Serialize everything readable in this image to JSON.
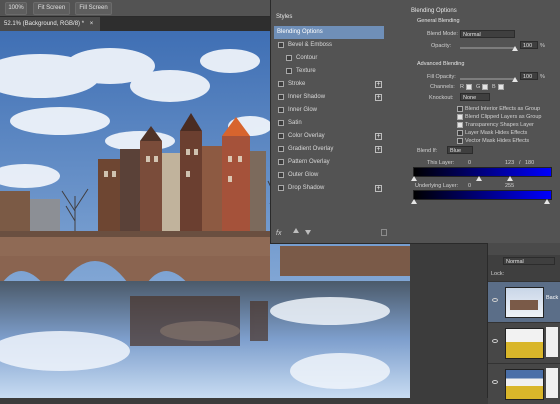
{
  "toolbar": {
    "btn1": "100%",
    "btn2": "Fit Screen",
    "btn3": "Fill Screen"
  },
  "document": {
    "tab_title": "52.1% (Background, RGB/8) *",
    "close_glyph": "×"
  },
  "layer_style": {
    "styles_header": "Styles",
    "items": [
      {
        "label": "Blending Options",
        "selected": true,
        "checkbox": false,
        "plus": false,
        "indent": false
      },
      {
        "label": "Bevel & Emboss",
        "checkbox": true,
        "checked": false,
        "plus": false,
        "indent": false
      },
      {
        "label": "Contour",
        "checkbox": true,
        "checked": false,
        "plus": false,
        "indent": true
      },
      {
        "label": "Texture",
        "checkbox": true,
        "checked": false,
        "plus": false,
        "indent": true
      },
      {
        "label": "Stroke",
        "checkbox": true,
        "checked": false,
        "plus": true,
        "indent": false
      },
      {
        "label": "Inner Shadow",
        "checkbox": true,
        "checked": false,
        "plus": true,
        "indent": false
      },
      {
        "label": "Inner Glow",
        "checkbox": true,
        "checked": false,
        "plus": false,
        "indent": false
      },
      {
        "label": "Satin",
        "checkbox": true,
        "checked": false,
        "plus": false,
        "indent": false
      },
      {
        "label": "Color Overlay",
        "checkbox": true,
        "checked": false,
        "plus": true,
        "indent": false
      },
      {
        "label": "Gradient Overlay",
        "checkbox": true,
        "checked": false,
        "plus": true,
        "indent": false
      },
      {
        "label": "Pattern Overlay",
        "checkbox": true,
        "checked": false,
        "plus": false,
        "indent": false
      },
      {
        "label": "Outer Glow",
        "checkbox": true,
        "checked": false,
        "plus": false,
        "indent": false
      },
      {
        "label": "Drop Shadow",
        "checkbox": true,
        "checked": false,
        "plus": true,
        "indent": false
      }
    ],
    "bottom_icons": [
      "fx-icon",
      "arrow-up-icon",
      "arrow-down-icon",
      "trash-icon"
    ],
    "fx_label": "fx"
  },
  "blending": {
    "title": "Blending Options",
    "general": "General Blending",
    "blend_mode_label": "Blend Mode:",
    "blend_mode_value": "Normal",
    "opacity_label": "Opacity:",
    "opacity_value": "100",
    "opacity_fraction": 1.0,
    "percent": "%",
    "advanced": "Advanced Blending",
    "fill_opacity_label": "Fill Opacity:",
    "fill_opacity_value": "100",
    "fill_fraction": 1.0,
    "channels_label": "Channels:",
    "channels": [
      {
        "name": "R",
        "checked": true
      },
      {
        "name": "G",
        "checked": true
      },
      {
        "name": "B",
        "checked": true
      }
    ],
    "knockout_label": "Knockout:",
    "knockout_value": "None",
    "checks": [
      {
        "label": "Blend Interior Effects as Group",
        "checked": false
      },
      {
        "label": "Blend Clipped Layers as Group",
        "checked": true
      },
      {
        "label": "Transparency Shapes Layer",
        "checked": true
      },
      {
        "label": "Layer Mask Hides Effects",
        "checked": false
      },
      {
        "label": "Vector Mask Hides Effects",
        "checked": false
      }
    ],
    "blend_if_label": "Blend If:",
    "blend_if_value": "Blue",
    "this_layer_label": "This Layer:",
    "this_layer_values": [
      "0",
      "123",
      "/",
      "180"
    ],
    "this_layer_split": [
      123,
      180
    ],
    "underlying_label": "Underlying Layer:",
    "underlying_values": [
      "0",
      "255"
    ],
    "colors": {
      "accent": "#6f8fb8",
      "blue_ramp_end": "#0000ff"
    }
  },
  "layers": {
    "mode": "Normal",
    "lock_label": "Lock:",
    "rows": [
      {
        "name": "Back",
        "selected": true
      },
      {
        "name": "",
        "selected": false
      },
      {
        "name": "",
        "selected": false
      }
    ]
  }
}
